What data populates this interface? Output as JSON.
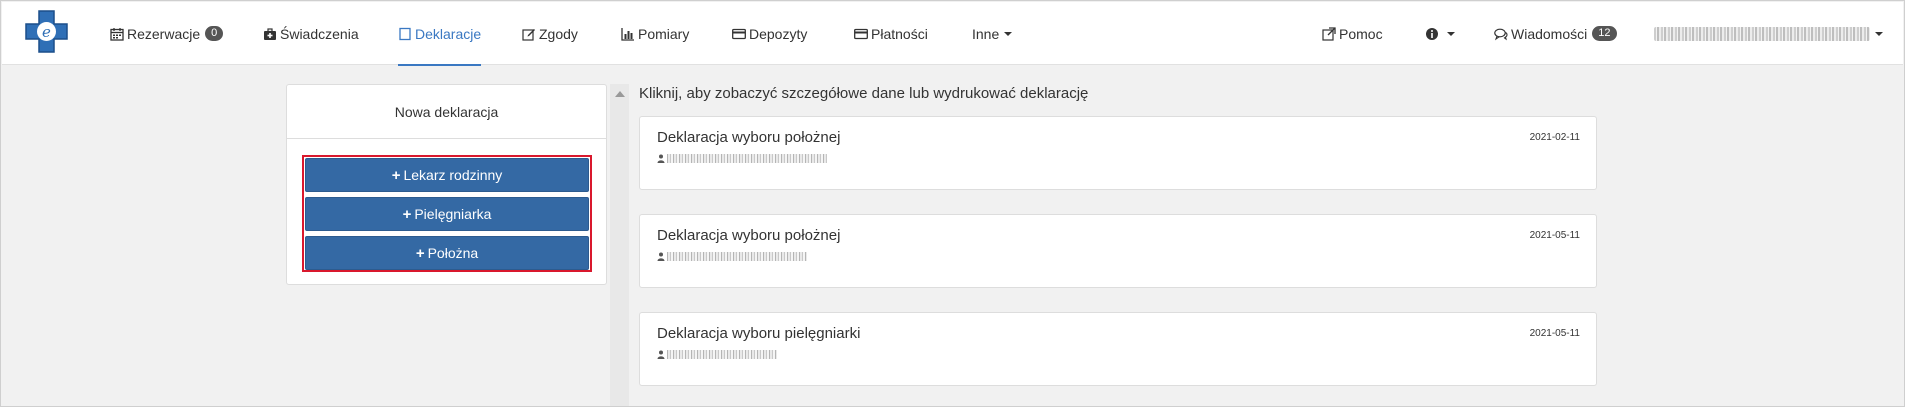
{
  "nav": {
    "items": [
      {
        "label": "Rezerwacje",
        "badge": "0",
        "icon": "calendar-icon"
      },
      {
        "label": "Świadczenia",
        "icon": "medkit-icon"
      },
      {
        "label": "Deklaracje",
        "icon": "file-icon",
        "active": true
      },
      {
        "label": "Zgody",
        "icon": "edit-icon"
      },
      {
        "label": "Pomiary",
        "icon": "bar-chart-icon"
      },
      {
        "label": "Depozyty",
        "icon": "card-icon"
      },
      {
        "label": "Płatności",
        "icon": "credit-card-icon"
      },
      {
        "label": "Inne",
        "icon": "caret-down-icon"
      }
    ],
    "right": {
      "help_label": "Pomoc",
      "messages_label": "Wiadomości",
      "messages_badge": "12"
    }
  },
  "new_declaration": {
    "title": "Nowa deklaracja",
    "buttons": [
      "Lekarz rodzinny",
      "Pielęgniarka",
      "Położna"
    ]
  },
  "hint": "Kliknij, aby zobaczyć szczegółowe dane lub wydrukować deklarację",
  "declarations": [
    {
      "title": "Deklaracja wyboru położnej",
      "date": "2021-02-11"
    },
    {
      "title": "Deklaracja wyboru położnej",
      "date": "2021-05-11"
    },
    {
      "title": "Deklaracja wyboru pielęgniarki",
      "date": "2021-05-11"
    }
  ],
  "colors": {
    "accent": "#3a78c2",
    "button": "#3469a4",
    "highlight": "#d9182d"
  }
}
